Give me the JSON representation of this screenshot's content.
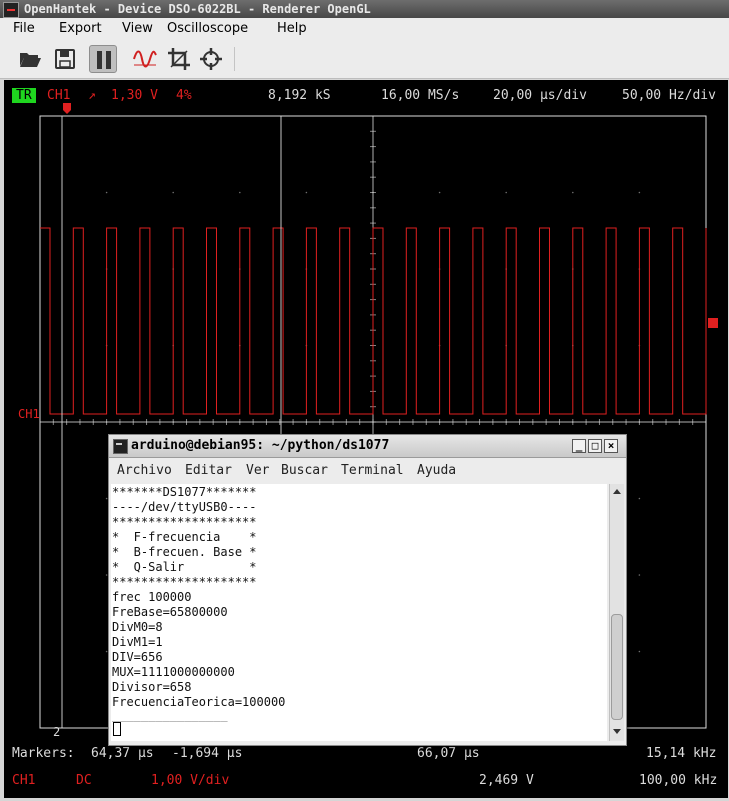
{
  "window": {
    "title": "OpenHantek - Device DSO-6022BL - Renderer OpenGL"
  },
  "menu": {
    "file": "File",
    "export": "Export",
    "view": "View",
    "oscilloscope": "Oscilloscope",
    "help": "Help"
  },
  "toolbar": {
    "icons": [
      "open-folder-icon",
      "save-icon",
      "pause-icon",
      "waveform-icon",
      "crop-icon",
      "crosshair-icon"
    ],
    "pause_pressed": true
  },
  "scope": {
    "top": {
      "trigger_badge": "TR",
      "channel": "CH1",
      "slope": "↗",
      "trigger_level": "1,30 V",
      "pretrigger": "4%",
      "samples": "8,192 kS",
      "samplerate": "16,00 MS/s",
      "timebase": "20,00 µs/div",
      "frequency": "50,00 Hz/div"
    },
    "ch1_label": "CH1",
    "marker2_label": "2",
    "markers": {
      "label": "Markers:",
      "m1": "64,37 µs",
      "m2": "-1,694 µs",
      "delta_t": "66,07 µs",
      "freq": "15,14 kHz"
    },
    "bottom": {
      "channel": "CH1",
      "coupling": "DC",
      "vdiv": "1,00 V/div",
      "voltage": "2,469 V",
      "fdiv": "100,00 kHz"
    },
    "colors": {
      "trace": "#e02020",
      "grid": "#dcdcdc",
      "trigger_badge": "#1fd61f"
    },
    "signal": {
      "type": "square",
      "cycles_visible": 20
    }
  },
  "terminal": {
    "title": "arduino@debian95: ~/python/ds1077",
    "menu": [
      "Archivo",
      "Editar",
      "Ver",
      "Buscar",
      "Terminal",
      "Ayuda"
    ],
    "lines": [
      "*******DS1077*******",
      "----/dev/ttyUSB0----",
      "********************",
      "*  F-frecuencia    *",
      "*  B-frecuen. Base *",
      "*  Q-Salir         *",
      "********************",
      "frec 100000",
      "FreBase=65800000",
      "DivM0=8",
      "DivM1=1",
      "DIV=656",
      "MUX=1111000000000",
      "Divisor=658",
      "FrecuenciaTeorica=100000",
      "",
      "________________"
    ]
  }
}
